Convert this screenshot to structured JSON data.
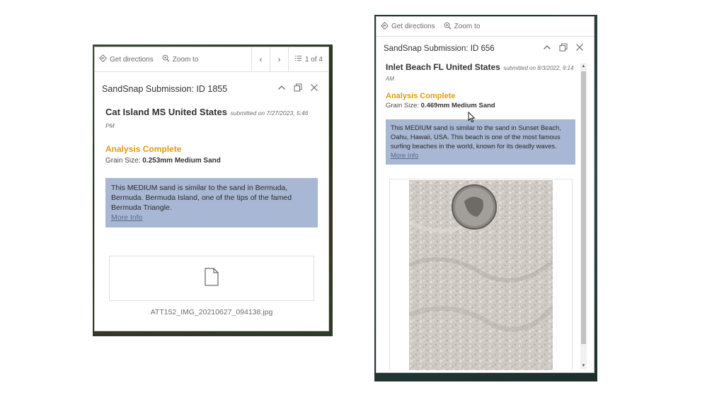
{
  "left_popup": {
    "actions": {
      "directions": "Get directions",
      "zoom": "Zoom to"
    },
    "pager": "1 of 4",
    "title": "SandSnap Submission: ID 1855",
    "place": "Cat Island MS United States",
    "submitted": "submitted on 7/27/2023, 5:46 PM",
    "status": "Analysis Complete",
    "grain_label": "Grain Size:",
    "grain_value": "0.253mm Medium Sand",
    "description": "This MEDIUM sand is similar to the sand in Bermuda, Bermuda. Bermuda Island, one of the tips of the famed Bermuda Triangle.",
    "more_info": "More Info",
    "attachment_name": "ATT152_IMG_20210627_094138.jpg"
  },
  "right_popup": {
    "actions": {
      "directions": "Get directions",
      "zoom": "Zoom to"
    },
    "title": "SandSnap Submission: ID 656",
    "place": "Inlet Beach FL United States",
    "submitted": "submitted on 8/3/2022, 9:14 AM",
    "status": "Analysis Complete",
    "grain_label": "Grain Size:",
    "grain_value": "0.469mm Medium Sand",
    "description": "This MEDIUM sand is similar to the sand in Sunset Beach, Oahu, Hawaii, USA. This beach is one of the most famous surfing beaches in the world, known for its deadly waves.",
    "more_info": "More Info"
  },
  "colors": {
    "status": "#e09a12",
    "description_bg": "#a8b7d3"
  }
}
